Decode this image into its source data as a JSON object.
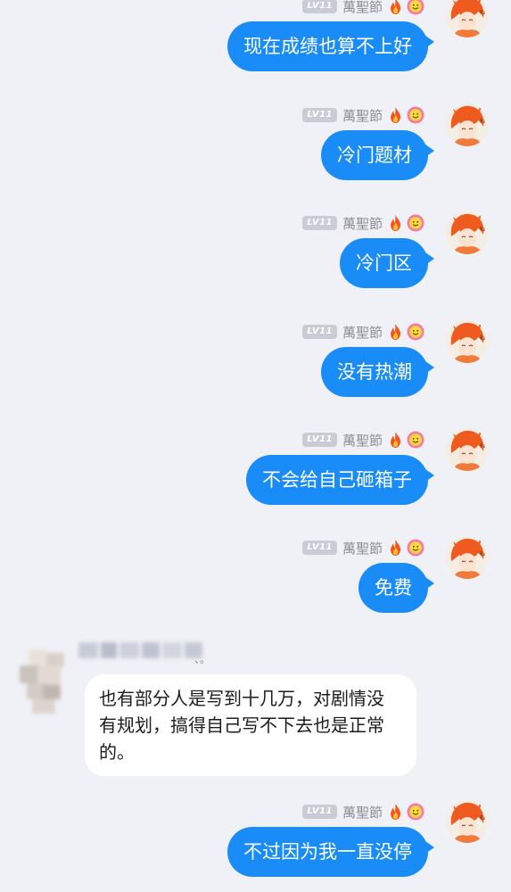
{
  "self_user": {
    "level": "LV11",
    "nickname": "萬聖節"
  },
  "messages": [
    {
      "text": "现在成绩也算不上好"
    },
    {
      "text": "冷门题材"
    },
    {
      "text": "冷门区"
    },
    {
      "text": "没有热潮"
    },
    {
      "text": "不会给自己砸箱子"
    },
    {
      "text": "免费"
    },
    {
      "text": "也有部分人是写到十几万，对剧情没有规划，搞得自己写不下去也是正常的。"
    },
    {
      "text": "不过因为我一直没停"
    }
  ],
  "other_user": {
    "name_suffix": "、。"
  },
  "colors": {
    "background": "#f0f1f6",
    "self_bubble": "#1a8cf8",
    "other_bubble": "#ffffff",
    "level_badge": "#c9ccd4",
    "nickname": "#8b8e96"
  },
  "icons": [
    "fire-icon",
    "smile-flower-icon",
    "user-avatar"
  ]
}
